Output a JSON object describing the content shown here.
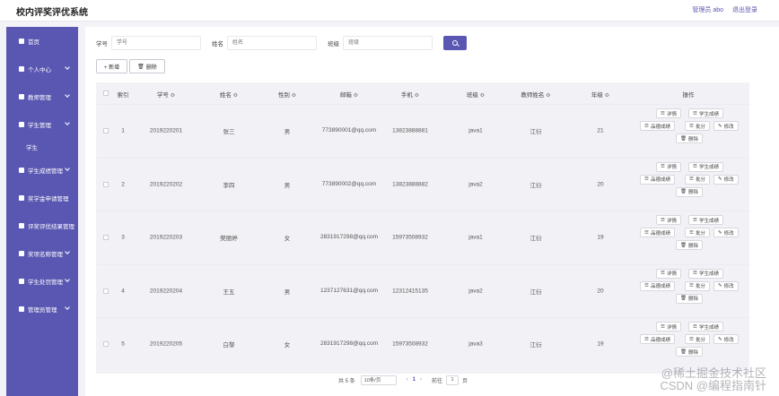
{
  "header": {
    "title": "校内评奖评优系统",
    "admin_label": "管理员 abo",
    "logout_label": "退出登录"
  },
  "sidebar": {
    "items": [
      {
        "label": "首页",
        "icon": "home-icon",
        "has_arrow": false
      },
      {
        "label": "个人中心",
        "icon": "user-icon",
        "has_arrow": true
      },
      {
        "label": "教师管理",
        "icon": "grid-icon",
        "has_arrow": true
      },
      {
        "label": "学生管理",
        "icon": "grid-icon",
        "has_arrow": true
      },
      {
        "label": "学生",
        "sub": true
      },
      {
        "label": "学生成绩管理",
        "icon": "folder-icon",
        "has_arrow": true
      },
      {
        "label": "奖学金申请管理",
        "icon": "user-icon",
        "has_arrow": false
      },
      {
        "label": "评奖评优结果管理",
        "icon": "user-icon",
        "has_arrow": false
      },
      {
        "label": "奖项名称管理",
        "icon": "grid-icon",
        "has_arrow": true
      },
      {
        "label": "学生处罚管理",
        "icon": "grid-icon",
        "has_arrow": true
      },
      {
        "label": "管理员管理",
        "icon": "heart-icon",
        "has_arrow": true
      }
    ]
  },
  "search": {
    "student_no_label": "学号",
    "student_no_placeholder": "学号",
    "name_label": "姓名",
    "name_placeholder": "姓名",
    "class_label": "班级",
    "class_placeholder": "班级"
  },
  "toolbar": {
    "add_label": "+ 新增",
    "delete_label": "删除"
  },
  "table": {
    "headers": [
      "索引",
      "学号 ≎",
      "姓名 ≎",
      "性别 ≎",
      "邮箱 ≎",
      "手机 ≎",
      "班级 ≎",
      "教师姓名 ≎",
      "年级 ≎",
      "操作"
    ],
    "rows": [
      {
        "index": "1",
        "student_no": "2019220201",
        "name": "张三",
        "gender": "男",
        "email": "773890001@qq.com",
        "phone": "13823888881",
        "class": "java1",
        "teacher": "江衍",
        "grade": "21"
      },
      {
        "index": "2",
        "student_no": "2019220202",
        "name": "李四",
        "gender": "男",
        "email": "773890002@qq.com",
        "phone": "13823888882",
        "class": "java2",
        "teacher": "江衍",
        "grade": "20"
      },
      {
        "index": "3",
        "student_no": "2019220203",
        "name": "樊丽婷",
        "gender": "女",
        "email": "2831917298@qq.com",
        "phone": "15973508932",
        "class": "java1",
        "teacher": "江衍",
        "grade": "19"
      },
      {
        "index": "4",
        "student_no": "2019220204",
        "name": "王五",
        "gender": "男",
        "email": "1237127631@qq.com",
        "phone": "12312415135",
        "class": "java2",
        "teacher": "江衍",
        "grade": "20"
      },
      {
        "index": "5",
        "student_no": "2019220205",
        "name": "白黎",
        "gender": "女",
        "email": "2831917298@qq.com",
        "phone": "15973508932",
        "class": "java3",
        "teacher": "江衍",
        "grade": "19"
      }
    ],
    "ops": {
      "detail": "详情",
      "scores": "学生成绩",
      "award": "品德成绩",
      "review": "批分",
      "edit": "修改",
      "delete": "删除"
    }
  },
  "pagination": {
    "total": "共 5 条",
    "page_size": "10条/页",
    "prev": "‹",
    "current": "1",
    "next": "›",
    "goto_label": "前往",
    "goto_value": "1",
    "page_suffix": "页"
  },
  "watermark": {
    "line1": "@稀土掘金技术社区",
    "line2": "CSDN @编程指南针"
  }
}
